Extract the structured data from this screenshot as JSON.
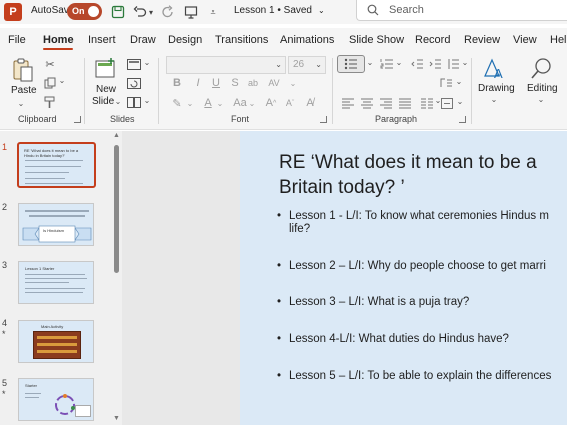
{
  "titlebar": {
    "app_logo": "P",
    "autosave_label": "AutoSave",
    "autosave_state": "On",
    "doc_title": "Lesson 1 • Saved",
    "search_placeholder": "Search"
  },
  "menu": [
    "File",
    "Home",
    "Insert",
    "Draw",
    "Design",
    "Transitions",
    "Animations",
    "Slide Show",
    "Record",
    "Review",
    "View",
    "Help"
  ],
  "ribbon": {
    "paste_label": "Paste",
    "new_slide_label_1": "New",
    "new_slide_label_2": "Slide",
    "font_size": "26",
    "drawing_label": "Drawing",
    "editing_label": "Editing",
    "groups": {
      "clipboard": "Clipboard",
      "slides": "Slides",
      "font": "Font",
      "paragraph": "Paragraph"
    }
  },
  "thumbnails": [
    {
      "num": "1",
      "star": "",
      "title": "RE 'What does it mean to be a Hindu in Britain today?'"
    },
    {
      "num": "2",
      "star": "",
      "title": "Is Hinduism"
    },
    {
      "num": "3",
      "star": "",
      "title": "Lesson 1 Starter"
    },
    {
      "num": "4",
      "star": "*",
      "title": "Main Activity"
    },
    {
      "num": "5",
      "star": "*",
      "title": "Starter"
    }
  ],
  "slide": {
    "title_line1": "RE ‘What does it mean to be a",
    "title_line2": "Britain today? ’",
    "bullets": [
      {
        "line1": "Lesson 1 - L/I: To know what ceremonies Hindus m",
        "line2": "life?"
      },
      {
        "line1": "Lesson 2 – L/I: Why do people choose to get marri",
        "line2": ""
      },
      {
        "line1": "Lesson 3 – L/I: What is a puja tray?",
        "line2": ""
      },
      {
        "line1": "Lesson 4-L/I: What duties do Hindus have?",
        "line2": ""
      },
      {
        "line1": "Lesson 5 – L/I: To be able to explain the differences",
        "line2": ""
      }
    ]
  },
  "colors": {
    "accent": "#c43e1c",
    "slide_bg": "#dbe9f6",
    "pane_bg": "#f0f0f0"
  }
}
